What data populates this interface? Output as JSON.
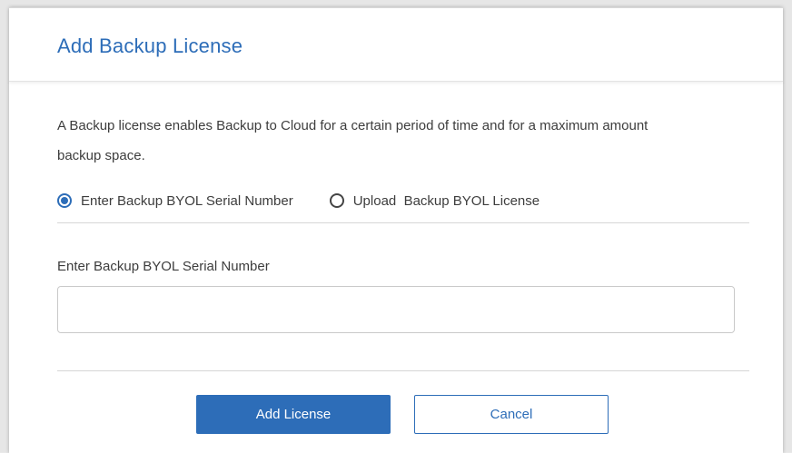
{
  "dialog": {
    "title": "Add Backup License",
    "description": "A Backup license enables Backup to Cloud for a certain period of time and for a maximum amount backup space.",
    "options": [
      {
        "label": "Enter Backup BYOL Serial Number",
        "selected": true
      },
      {
        "label": "Upload  Backup BYOL License",
        "selected": false
      }
    ],
    "serial_field": {
      "label": "Enter Backup BYOL Serial Number",
      "value": "",
      "placeholder": ""
    },
    "buttons": {
      "add_label": "Add License",
      "cancel_label": "Cancel"
    }
  },
  "colors": {
    "accent": "#2d6db8",
    "text": "#3d3d3d",
    "divider": "#d6d6d6"
  }
}
